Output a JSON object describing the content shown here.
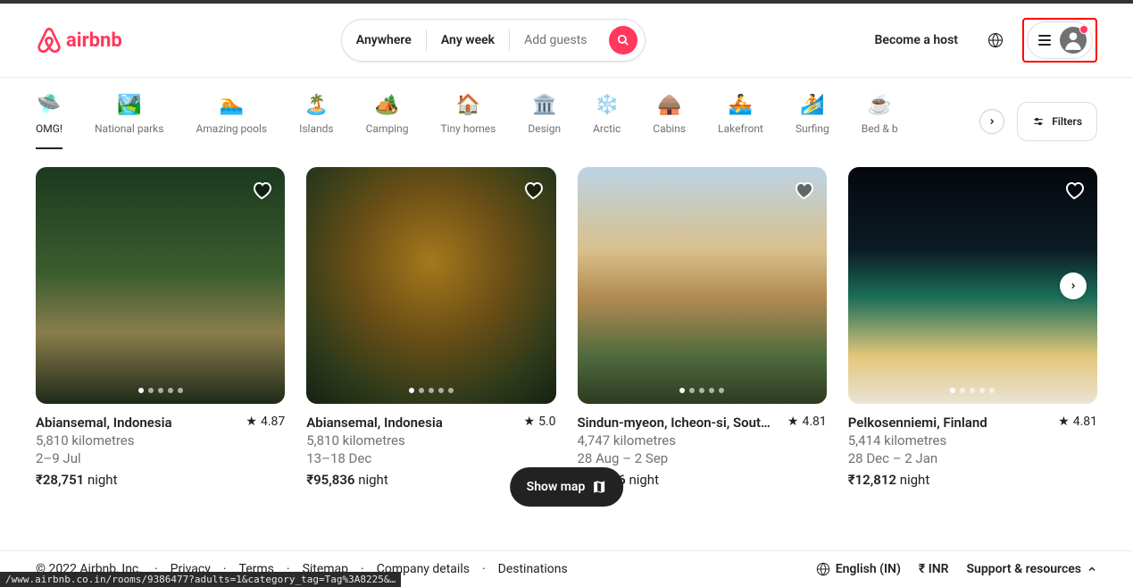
{
  "header": {
    "brand": "airbnb",
    "search": {
      "where": "Anywhere",
      "when": "Any week",
      "who": "Add guests"
    },
    "host_link": "Become a host"
  },
  "categories": [
    {
      "label": "OMG!",
      "icon": "🛸",
      "active": true
    },
    {
      "label": "National parks",
      "icon": "🏞️"
    },
    {
      "label": "Amazing pools",
      "icon": "🏊"
    },
    {
      "label": "Islands",
      "icon": "🏝️"
    },
    {
      "label": "Camping",
      "icon": "🏕️"
    },
    {
      "label": "Tiny homes",
      "icon": "🏠"
    },
    {
      "label": "Design",
      "icon": "🏛️"
    },
    {
      "label": "Arctic",
      "icon": "❄️"
    },
    {
      "label": "Cabins",
      "icon": "🛖"
    },
    {
      "label": "Lakefront",
      "icon": "🚣"
    },
    {
      "label": "Surfing",
      "icon": "🏄"
    },
    {
      "label": "Bed & b",
      "icon": "☕"
    }
  ],
  "filters_label": "Filters",
  "listings": [
    {
      "location": "Abiansemal, Indonesia",
      "rating": "4.87",
      "distance": "5,810 kilometres",
      "dates": "2–9 Jul",
      "price": "₹28,751",
      "price_suffix": " night"
    },
    {
      "location": "Abiansemal, Indonesia",
      "rating": "5.0",
      "distance": "5,810 kilometres",
      "dates": "13–18 Dec",
      "price": "₹95,836",
      "price_suffix": " night"
    },
    {
      "location": "Sindun-myeon, Icheon-si, Sout…",
      "rating": "4.81",
      "distance": "4,747 kilometres",
      "dates": "28 Aug – 2 Sep",
      "price": "₹10,906",
      "price_suffix": " night"
    },
    {
      "location": "Pelkosenniemi, Finland",
      "rating": "4.81",
      "distance": "5,414 kilometres",
      "dates": "28 Dec – 2 Jan",
      "price": "₹12,812",
      "price_suffix": " night"
    }
  ],
  "show_map": "Show map",
  "footer": {
    "copyright": "© 2022 Airbnb, Inc.",
    "links": [
      "Privacy",
      "Terms",
      "Sitemap",
      "Company details",
      "Destinations"
    ],
    "lang": "English (IN)",
    "currency": "₹  INR",
    "support": "Support & resources"
  },
  "status_url": "/www.airbnb.co.in/rooms/9386477?adults=1&category_tag=Tag%3A8225&…"
}
